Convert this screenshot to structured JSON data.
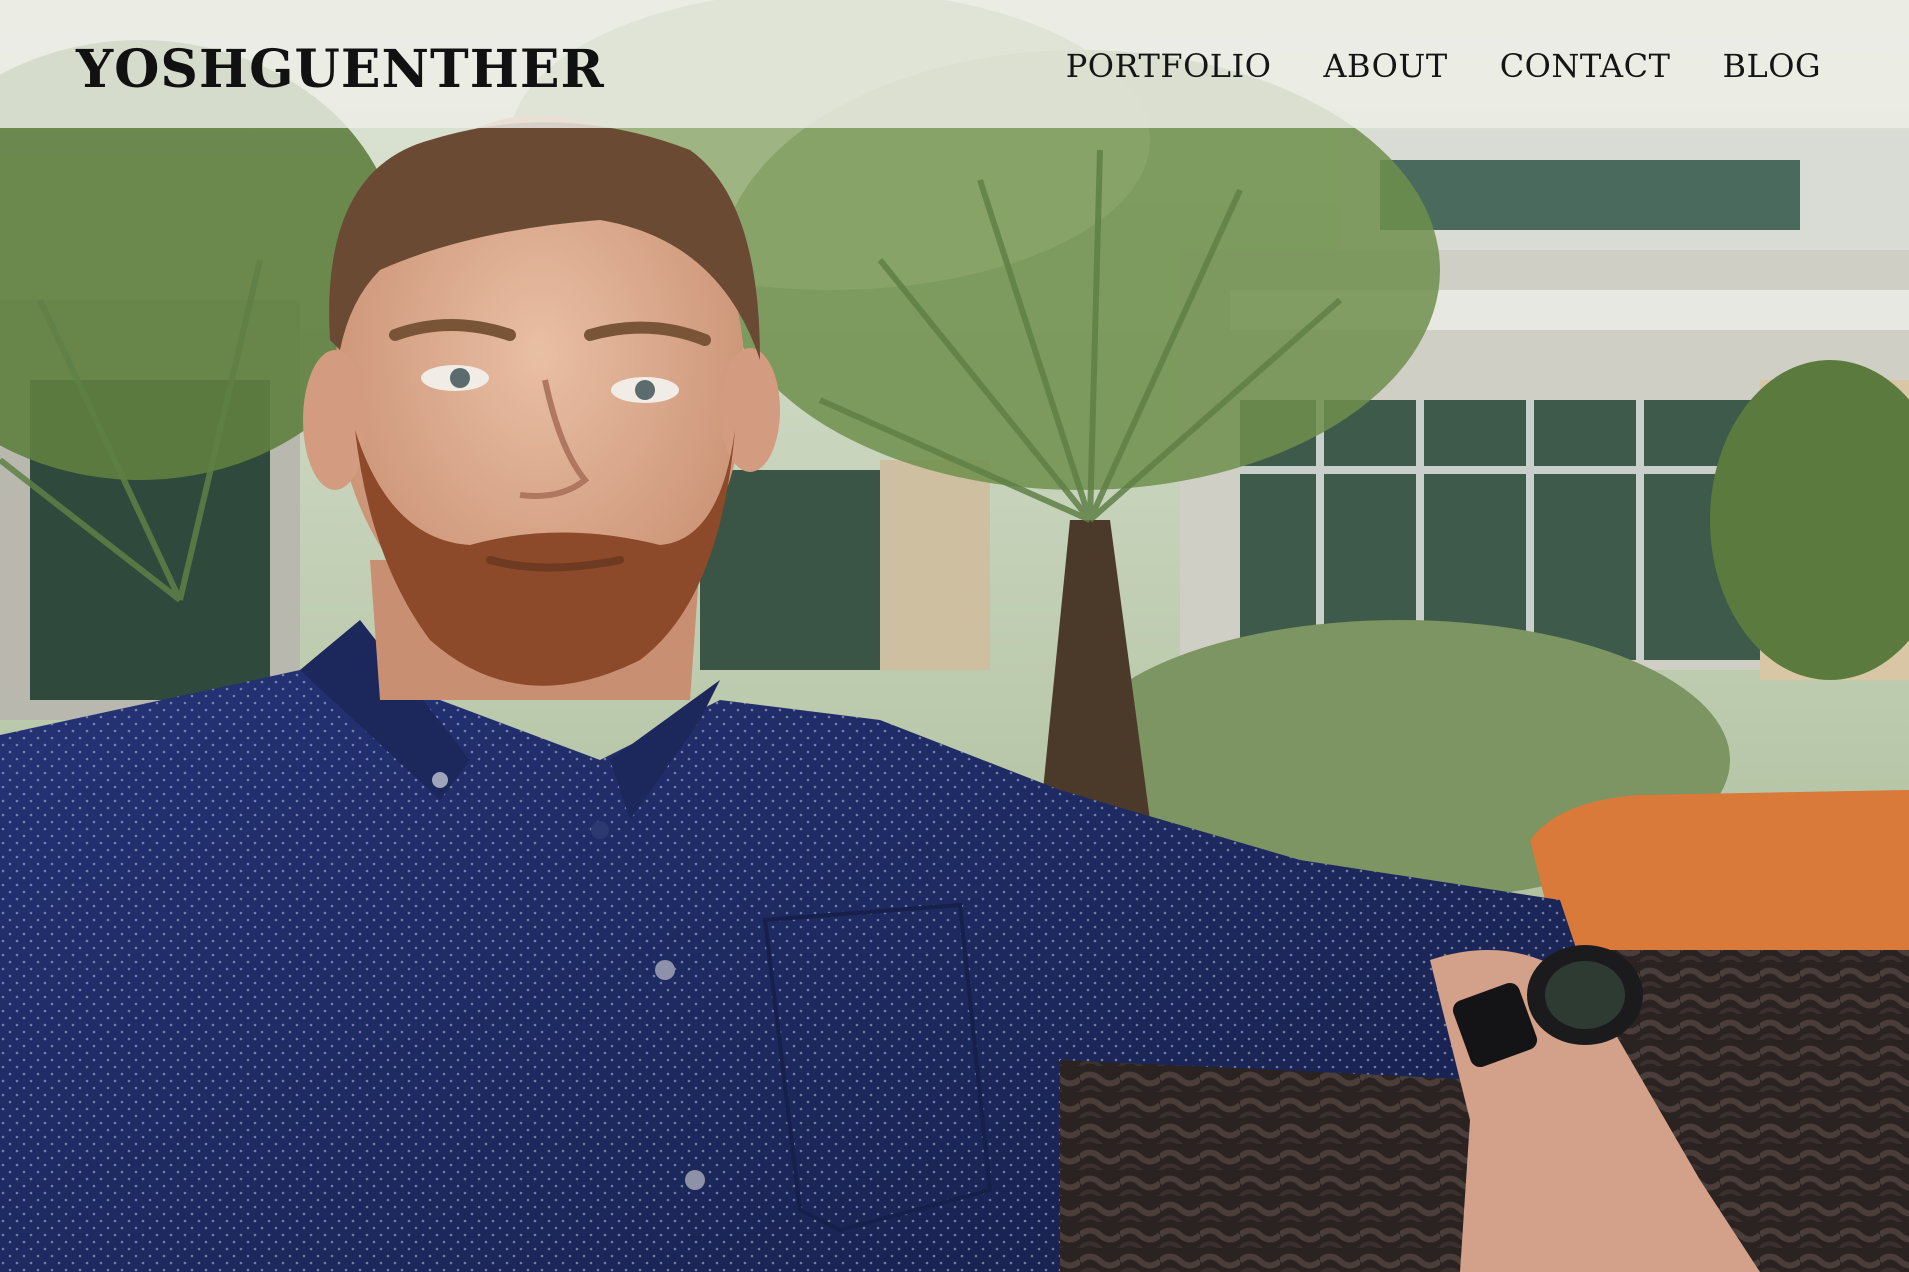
{
  "site": {
    "brand": "YOSHGUENTHER"
  },
  "nav": {
    "items": [
      {
        "label": "PORTFOLIO"
      },
      {
        "label": "ABOUT"
      },
      {
        "label": "CONTACT"
      },
      {
        "label": "BLOG"
      }
    ]
  },
  "colors": {
    "header_bg": "#eeeee8",
    "text": "#111111",
    "shirt": "#1f2c63",
    "foliage": "#5e7a4a",
    "cushion": "#d9793a"
  },
  "hero": {
    "icon": "portrait-photo"
  }
}
